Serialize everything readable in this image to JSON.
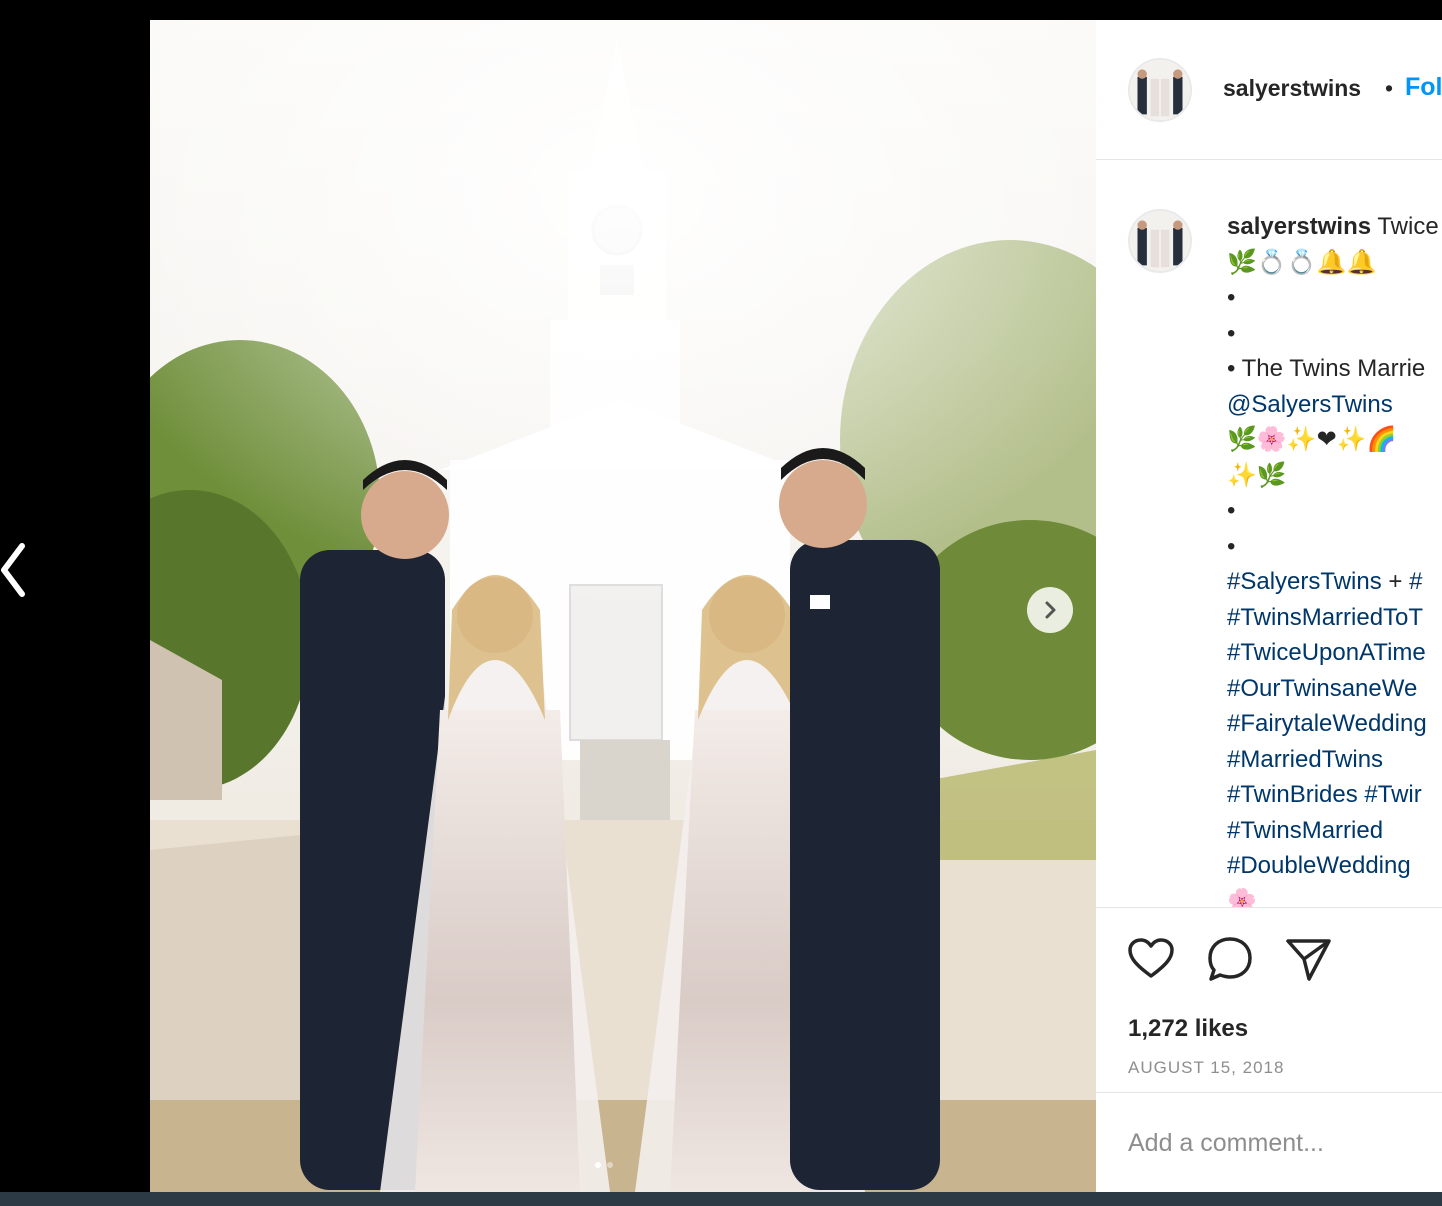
{
  "post": {
    "username": "salyerstwins",
    "separator": "•",
    "follow_label": "Fol",
    "caption": {
      "first_text": "Twice",
      "lines": [
        {
          "kind": "emoji",
          "text": "🌿💍💍🔔🔔"
        },
        {
          "kind": "text",
          "text": "•"
        },
        {
          "kind": "text",
          "text": "•"
        },
        {
          "kind": "text",
          "text": "• The Twins Marrie"
        },
        {
          "kind": "tag",
          "text": "@SalyersTwins"
        },
        {
          "kind": "emoji",
          "text": "🌿🌸✨❤✨🌈"
        },
        {
          "kind": "emoji",
          "text": "✨🌿"
        },
        {
          "kind": "text",
          "text": "•"
        },
        {
          "kind": "text",
          "text": "•"
        },
        {
          "kind": "mixed",
          "parts": [
            {
              "t": "tag",
              "v": "#SalyersTwins"
            },
            {
              "t": "text",
              "v": " + "
            },
            {
              "t": "tag",
              "v": "#"
            }
          ]
        },
        {
          "kind": "tag",
          "text": "#TwinsMarriedToT"
        },
        {
          "kind": "tag",
          "text": "#TwiceUponATime"
        },
        {
          "kind": "tag",
          "text": "#OurTwinsaneWe"
        },
        {
          "kind": "tag",
          "text": "#FairytaleWedding"
        },
        {
          "kind": "tag",
          "text": "#MarriedTwins"
        },
        {
          "kind": "mixed",
          "parts": [
            {
              "t": "tag",
              "v": "#TwinBrides"
            },
            {
              "t": "text",
              "v": " "
            },
            {
              "t": "tag",
              "v": "#Twir"
            }
          ]
        },
        {
          "kind": "tag",
          "text": "#TwinsMarried"
        },
        {
          "kind": "tag",
          "text": "#DoubleWedding"
        },
        {
          "kind": "emoji",
          "text": "🌸"
        }
      ]
    },
    "likes_label": "1,272 likes",
    "date": "AUGUST 15, 2018",
    "comment_placeholder": "Add a comment...",
    "carousel": {
      "count": 2,
      "active": 0
    }
  },
  "icons": {
    "prev": "chevron-left-icon",
    "next": "chevron-right-icon",
    "like": "heart-icon",
    "comment": "comment-bubble-icon",
    "share": "paper-plane-icon"
  },
  "colors": {
    "link": "#0095f6",
    "hashtag": "#00376b",
    "text": "#262626",
    "muted": "#8e8e8e"
  }
}
